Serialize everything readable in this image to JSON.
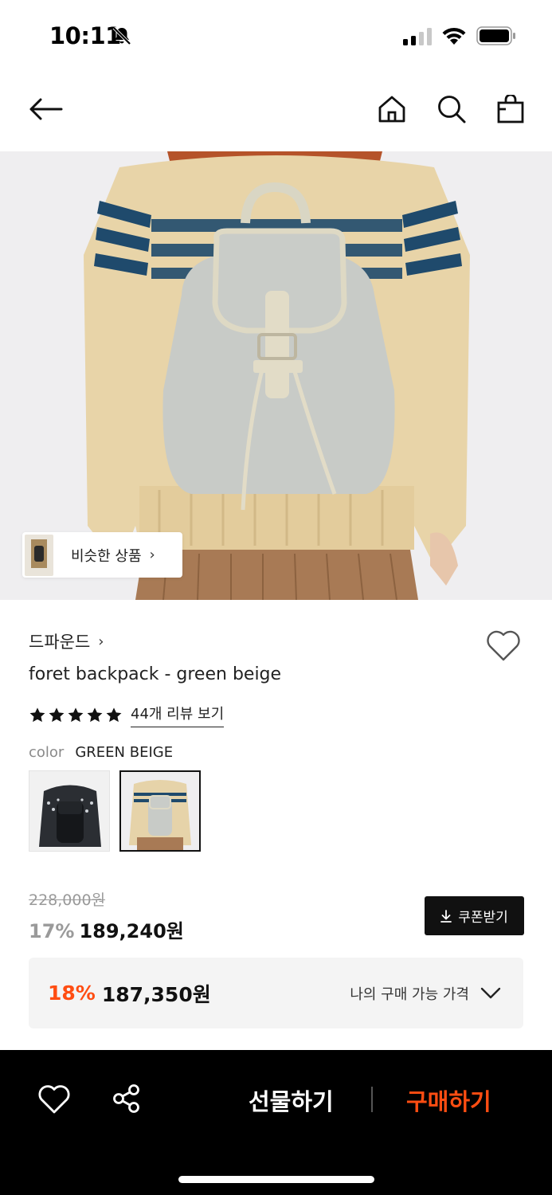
{
  "status_bar": {
    "time": "10:11",
    "icons": [
      "bell-slash-icon",
      "signal-icon",
      "wifi-icon",
      "battery-icon"
    ]
  },
  "nav": {
    "icons": [
      "back-arrow-icon",
      "home-icon",
      "search-icon",
      "shopping-bag-icon"
    ]
  },
  "hero": {
    "similar_label": "비슷한 상품",
    "similar_chevron": "›"
  },
  "product": {
    "brand": "드파운드",
    "brand_chevron": "›",
    "title": "foret backpack - green beige",
    "rating_stars": 5,
    "review_link": "44개 리뷰 보기",
    "color_label": "color",
    "color_value": "GREEN BEIGE",
    "swatches": [
      "black",
      "green beige"
    ],
    "selected_swatch": 1
  },
  "pricing": {
    "original_price": "228,000원",
    "discount": "17%",
    "price": "189,240원",
    "coupon_label": "쿠폰받기",
    "coupon_icon": "download-icon",
    "my_discount": "18%",
    "my_price": "187,350원",
    "my_price_label": "나의 구매 가능 가격"
  },
  "bottom_bar": {
    "gift_label": "선물하기",
    "buy_label": "구매하기",
    "icons": [
      "heart-icon",
      "share-icon"
    ]
  },
  "colors": {
    "accent": "#ff4d12",
    "dark": "#111111",
    "muted": "#9a9a9a"
  }
}
